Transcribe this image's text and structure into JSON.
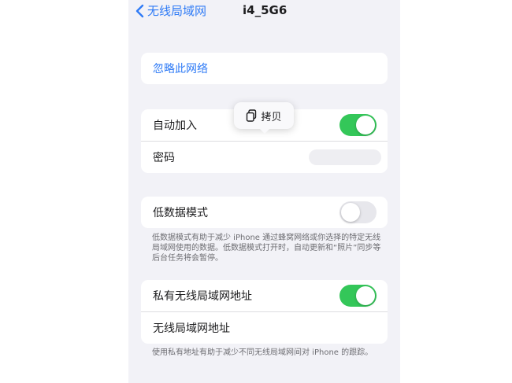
{
  "nav": {
    "back_label": "无线局域网",
    "title": "i4_5G6"
  },
  "forget": {
    "label": "忽略此网络"
  },
  "join": {
    "auto_join_label": "自动加入",
    "auto_join_on": true,
    "password_label": "密码"
  },
  "popover": {
    "copy_label": "拷贝"
  },
  "low_data": {
    "label": "低数据模式",
    "on": false,
    "footnote": "低数据模式有助于减少 iPhone 通过蜂窝网络或你选择的特定无线局域网使用的数据。低数据模式打开时，自动更新和“照片”同步等后台任务将会暂停。"
  },
  "private_addr": {
    "label": "私有无线局域网地址",
    "on": true,
    "wifi_addr_label": "无线局域网地址",
    "footnote": "使用私有地址有助于减少不同无线局域网间对 iPhone 的跟踪。"
  },
  "colors": {
    "accent": "#2f7bf6",
    "toggle_on": "#34c759",
    "toggle_off": "#e7e7ec",
    "background": "#f2f2f7"
  },
  "icons": {
    "back": "chevron-left-icon",
    "copy": "copy-icon"
  }
}
